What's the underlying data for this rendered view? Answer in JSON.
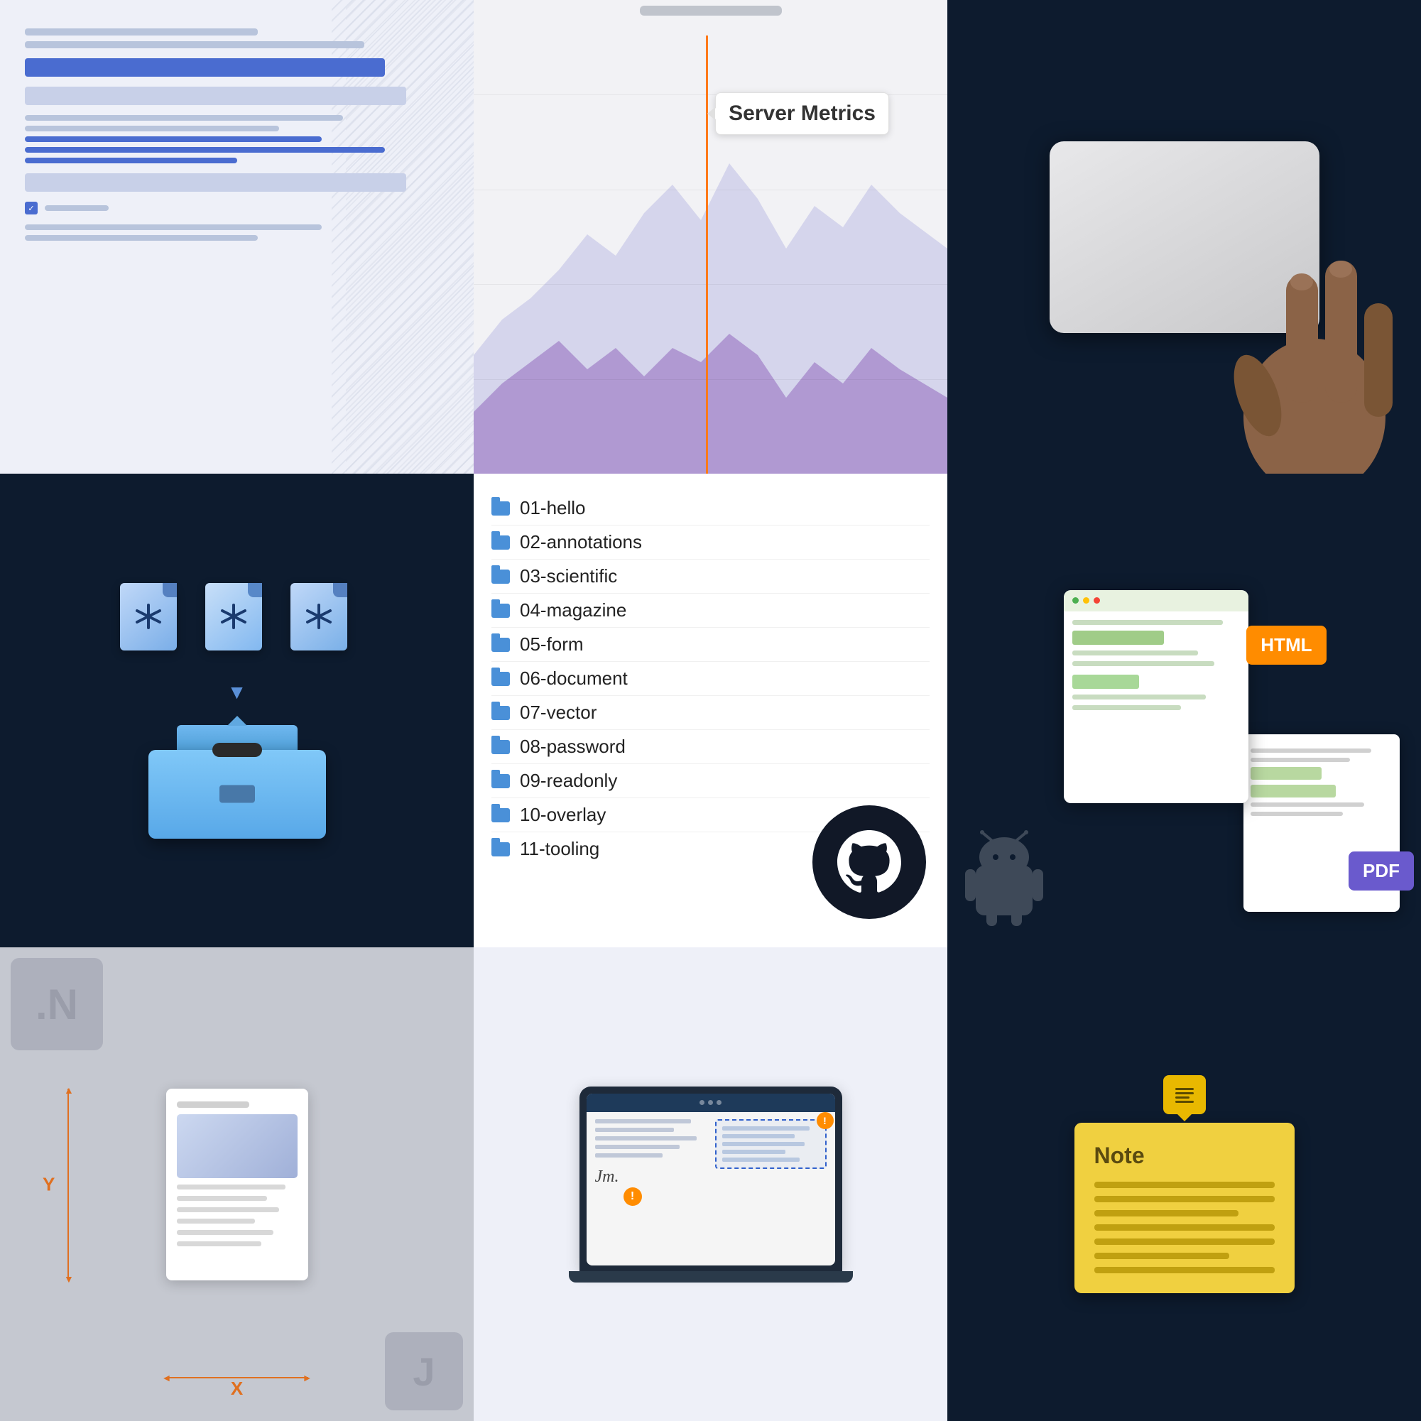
{
  "grid": {
    "cells": [
      {
        "id": "cell-1",
        "type": "wireframe-list",
        "bg": "#eef0f8"
      },
      {
        "id": "cell-2",
        "type": "chart",
        "bg": "#f2f2f5",
        "tooltip": {
          "title": "Server Metrics"
        }
      },
      {
        "id": "cell-3",
        "type": "trackpad-hand",
        "bg": "#0d1b2e"
      },
      {
        "id": "cell-4",
        "type": "pdf-toolbox",
        "bg": "#0d1b2e"
      },
      {
        "id": "cell-5",
        "type": "file-list",
        "bg": "#ffffff",
        "files": [
          "01-hello",
          "02-annotations",
          "03-scientific",
          "04-magazine",
          "05-form",
          "06-document",
          "07-vector",
          "08-password",
          "09-readonly",
          "10-overlay",
          "11-tooling"
        ]
      },
      {
        "id": "cell-6",
        "type": "browser-html-pdf",
        "bg": "#0d1b2e",
        "html_label": "HTML",
        "pdf_label": "PDF"
      },
      {
        "id": "cell-7",
        "type": "dimension-doc",
        "bg": "#c5c8d0",
        "x_label": "X",
        "y_label": "Y"
      },
      {
        "id": "cell-8",
        "type": "laptop-form",
        "bg": "#eef0f8"
      },
      {
        "id": "cell-9",
        "type": "note",
        "bg": "#0d1b2e",
        "note_title": "Note",
        "lines": [
          "full",
          "full",
          "short",
          "full",
          "full",
          "short",
          "full"
        ]
      }
    ]
  }
}
